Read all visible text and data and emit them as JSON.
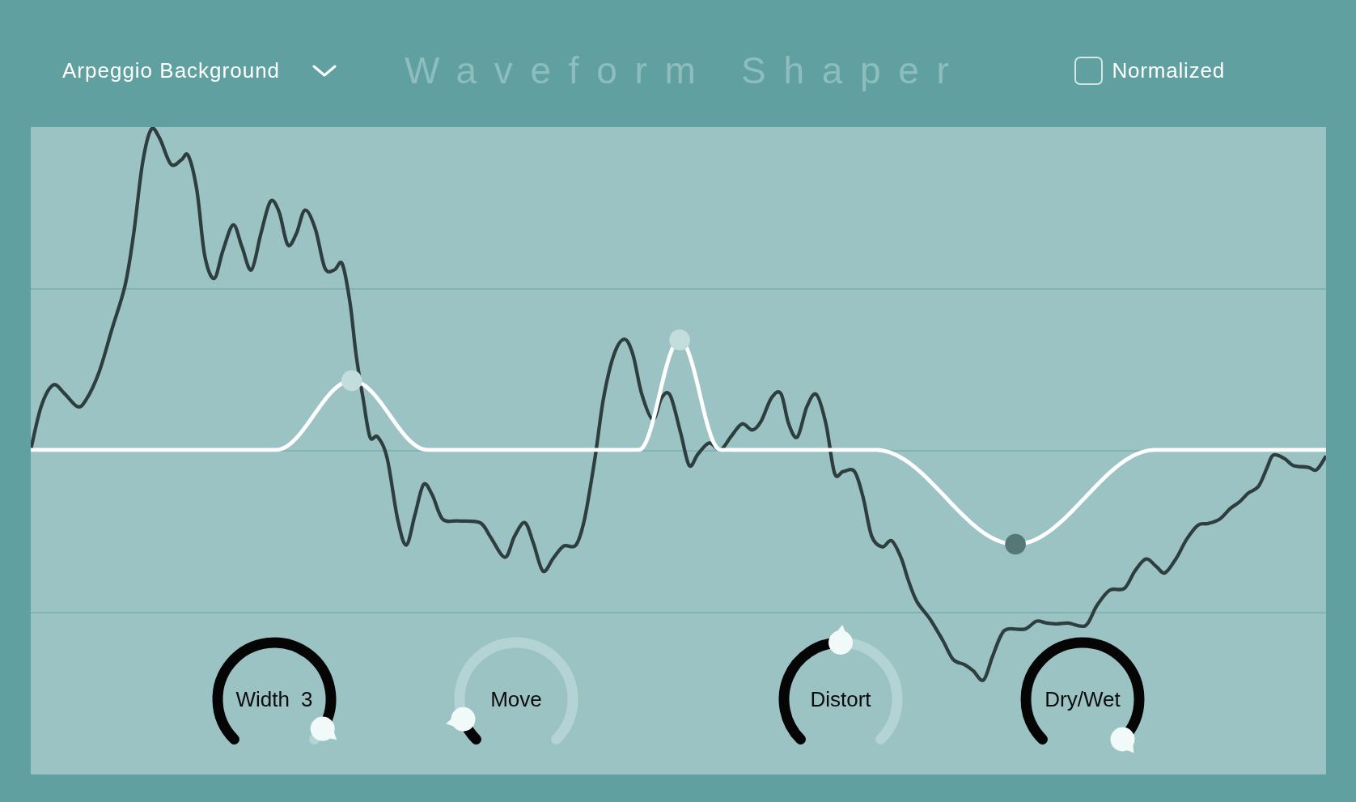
{
  "header": {
    "preset_dropdown": {
      "value": "Arpeggio Background"
    },
    "title": "Waveform Shaper",
    "normalized_checkbox": {
      "label": "Normalized",
      "checked": false
    }
  },
  "knobs": [
    {
      "label": "Width",
      "value": "3",
      "level": 0.95
    },
    {
      "label": "Move",
      "level": 0.09
    },
    {
      "label": "Distort",
      "level": 0.5
    },
    {
      "label": "Dry/Wet",
      "level": 1
    }
  ]
}
